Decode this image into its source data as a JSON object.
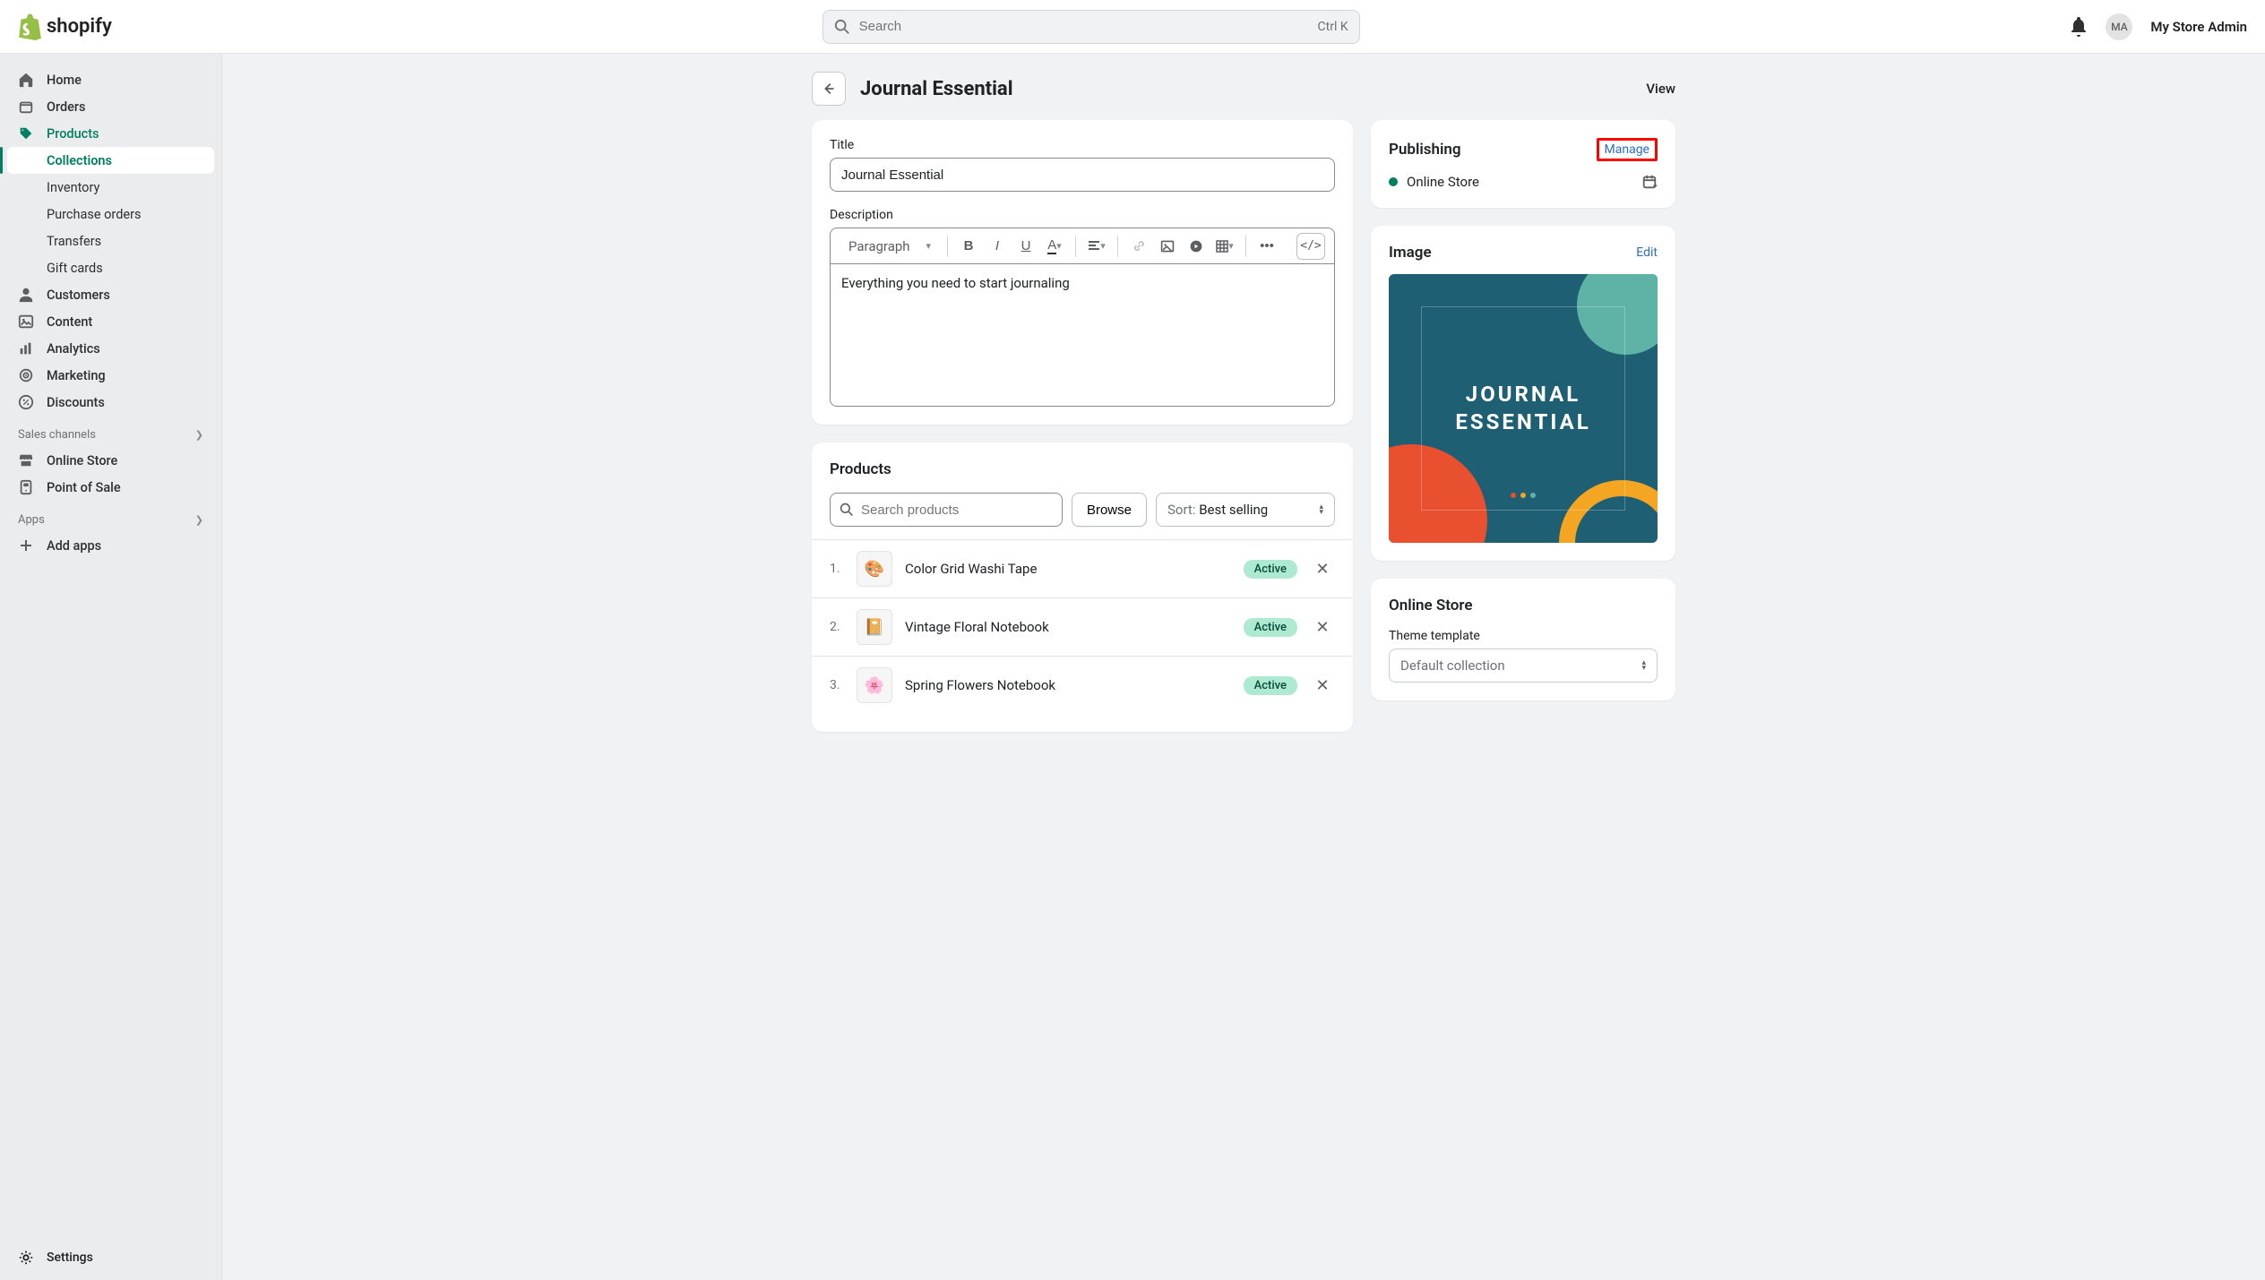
{
  "topbar": {
    "brand": "shopify",
    "search_placeholder": "Search",
    "search_kbd": "Ctrl K",
    "avatar_initials": "MA",
    "store_name": "My Store Admin"
  },
  "sidebar": {
    "items": [
      {
        "label": "Home",
        "icon": "home"
      },
      {
        "label": "Orders",
        "icon": "orders"
      },
      {
        "label": "Products",
        "icon": "products",
        "active": true,
        "subs": [
          {
            "label": "Collections",
            "selected": true
          },
          {
            "label": "Inventory"
          },
          {
            "label": "Purchase orders"
          },
          {
            "label": "Transfers"
          },
          {
            "label": "Gift cards"
          }
        ]
      },
      {
        "label": "Customers",
        "icon": "customers"
      },
      {
        "label": "Content",
        "icon": "content"
      },
      {
        "label": "Analytics",
        "icon": "analytics"
      },
      {
        "label": "Marketing",
        "icon": "marketing"
      },
      {
        "label": "Discounts",
        "icon": "discounts"
      }
    ],
    "sales_channels_header": "Sales channels",
    "channels": [
      {
        "label": "Online Store",
        "icon": "store"
      },
      {
        "label": "Point of Sale",
        "icon": "pos"
      }
    ],
    "apps_header": "Apps",
    "add_apps": "Add apps",
    "settings": "Settings"
  },
  "page": {
    "title": "Journal Essential",
    "view_action": "View"
  },
  "form": {
    "title_label": "Title",
    "title_value": "Journal Essential",
    "description_label": "Description",
    "paragraph_label": "Paragraph",
    "description_value": "Everything you need to start journaling"
  },
  "products_card": {
    "title": "Products",
    "search_placeholder": "Search products",
    "browse_label": "Browse",
    "sort_prefix": "Sort:",
    "sort_value": "Best selling",
    "items": [
      {
        "num": "1.",
        "name": "Color Grid Washi Tape",
        "status": "Active"
      },
      {
        "num": "2.",
        "name": "Vintage Floral Notebook",
        "status": "Active"
      },
      {
        "num": "3.",
        "name": "Spring Flowers Notebook",
        "status": "Active"
      }
    ]
  },
  "publishing": {
    "title": "Publishing",
    "manage": "Manage",
    "channel": "Online Store"
  },
  "image_card": {
    "title": "Image",
    "edit": "Edit",
    "alt_line1": "JOURNAL",
    "alt_line2": "ESSENTIAL"
  },
  "online_store_card": {
    "title": "Online Store",
    "template_label": "Theme template",
    "template_value": "Default collection"
  }
}
